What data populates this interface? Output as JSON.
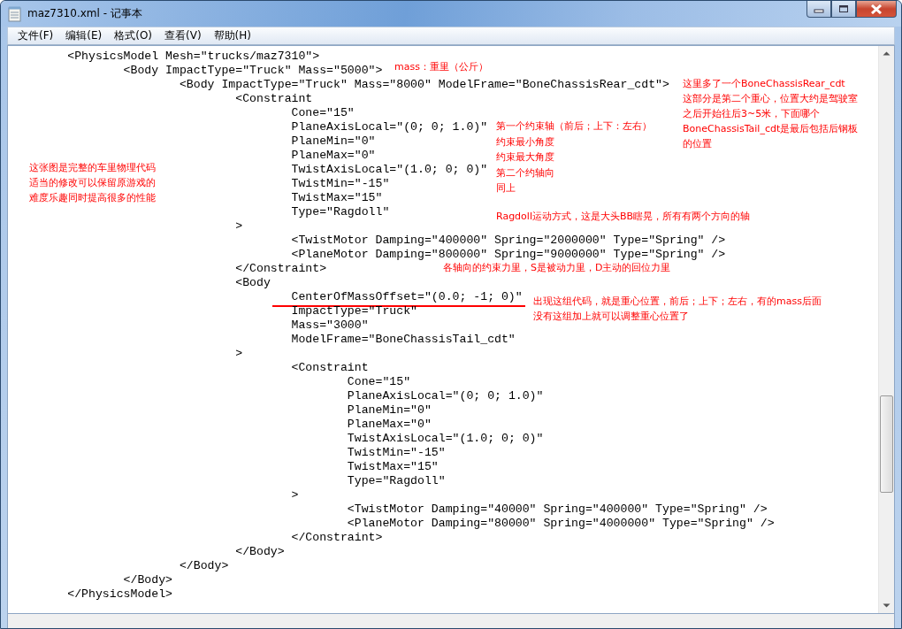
{
  "window": {
    "title": "maz7310.xml - 记事本"
  },
  "menu": [
    "文件(F)",
    "编辑(E)",
    "格式(O)",
    "查看(V)",
    "帮助(H)"
  ],
  "lines": [
    {
      "text": "\t<PhysicsModel Mesh=\"trucks/maz7310\">",
      "underlined": false
    },
    {
      "text": "\t\t<Body ImpactType=\"Truck\" Mass=\"5000\">",
      "underlined": false
    },
    {
      "text": "\t\t\t<Body ImpactType=\"Truck\" Mass=\"8000\" ModelFrame=\"BoneChassisRear_cdt\">",
      "underlined": false
    },
    {
      "text": "\t\t\t\t<Constraint",
      "underlined": false
    },
    {
      "text": "\t\t\t\t\tCone=\"15\"",
      "underlined": false
    },
    {
      "text": "\t\t\t\t\tPlaneAxisLocal=\"(0; 0; 1.0)\"",
      "underlined": false
    },
    {
      "text": "\t\t\t\t\tPlaneMin=\"0\"",
      "underlined": false
    },
    {
      "text": "\t\t\t\t\tPlaneMax=\"0\"",
      "underlined": false
    },
    {
      "text": "\t\t\t\t\tTwistAxisLocal=\"(1.0; 0; 0)\"",
      "underlined": false
    },
    {
      "text": "\t\t\t\t\tTwistMin=\"-15\"",
      "underlined": false
    },
    {
      "text": "\t\t\t\t\tTwistMax=\"15\"",
      "underlined": false
    },
    {
      "text": "\t\t\t\t\tType=\"Ragdoll\"",
      "underlined": false
    },
    {
      "text": "\t\t\t\t>",
      "underlined": false
    },
    {
      "text": "\t\t\t\t\t<TwistMotor Damping=\"400000\" Spring=\"2000000\" Type=\"Spring\" />",
      "underlined": false
    },
    {
      "text": "\t\t\t\t\t<PlaneMotor Damping=\"800000\" Spring=\"9000000\" Type=\"Spring\" />",
      "underlined": false
    },
    {
      "text": "\t\t\t\t</Constraint>",
      "underlined": false
    },
    {
      "text": "\t\t\t\t<Body",
      "underlined": false
    },
    {
      "text": "\t\t\t\t\tCenterOfMassOffset=\"(0.0; -1; 0)\"",
      "underlined": true
    },
    {
      "text": "\t\t\t\t\tImpactType=\"Truck\"",
      "underlined": false
    },
    {
      "text": "\t\t\t\t\tMass=\"3000\"",
      "underlined": false
    },
    {
      "text": "\t\t\t\t\tModelFrame=\"BoneChassisTail_cdt\"",
      "underlined": false
    },
    {
      "text": "\t\t\t\t>",
      "underlined": false
    },
    {
      "text": "\t\t\t\t\t<Constraint",
      "underlined": false
    },
    {
      "text": "\t\t\t\t\t\tCone=\"15\"",
      "underlined": false
    },
    {
      "text": "\t\t\t\t\t\tPlaneAxisLocal=\"(0; 0; 1.0)\"",
      "underlined": false
    },
    {
      "text": "\t\t\t\t\t\tPlaneMin=\"0\"",
      "underlined": false
    },
    {
      "text": "\t\t\t\t\t\tPlaneMax=\"0\"",
      "underlined": false
    },
    {
      "text": "\t\t\t\t\t\tTwistAxisLocal=\"(1.0; 0; 0)\"",
      "underlined": false
    },
    {
      "text": "\t\t\t\t\t\tTwistMin=\"-15\"",
      "underlined": false
    },
    {
      "text": "\t\t\t\t\t\tTwistMax=\"15\"",
      "underlined": false
    },
    {
      "text": "\t\t\t\t\t\tType=\"Ragdoll\"",
      "underlined": false
    },
    {
      "text": "\t\t\t\t\t>",
      "underlined": false
    },
    {
      "text": "\t\t\t\t\t\t<TwistMotor Damping=\"40000\" Spring=\"400000\" Type=\"Spring\" />",
      "underlined": false
    },
    {
      "text": "\t\t\t\t\t\t<PlaneMotor Damping=\"80000\" Spring=\"4000000\" Type=\"Spring\" />",
      "underlined": false
    },
    {
      "text": "\t\t\t\t\t</Constraint>",
      "underlined": false
    },
    {
      "text": "\t\t\t\t</Body>",
      "underlined": false
    },
    {
      "text": "\t\t\t</Body>",
      "underlined": false
    },
    {
      "text": "\t\t</Body>",
      "underlined": false
    },
    {
      "text": "\t</PhysicsModel>",
      "underlined": false
    }
  ],
  "annotations": [
    "mass：重里（公斤）",
    "这里多了一个BoneChassisRear_cdt",
    "这部分是第二个重心，位置大约是驾驶室",
    "之后开始往后3~5米，下面哪个",
    "BoneChassisTail_cdt是最后包括后钢板",
    "的位置",
    "第一个约束轴（前后；上下：左右）",
    "约束最小角度",
    "约束最大角度",
    "第二个约轴向",
    "同上",
    "Ragdoll运动方式，这是大头BB瞎晃，所有有两个方向的轴",
    "各轴向的约束力里，S是被动力里，D主动的回位力里",
    "出现这组代码，就是重心位置，前后；上下；左右，有的mass后面",
    "没有这组加上就可以调整重心位置了",
    "这张图是完整的车里物理代码",
    "适当的修改可以保留原游戏的",
    "难度乐趣同时提高很多的性能"
  ]
}
